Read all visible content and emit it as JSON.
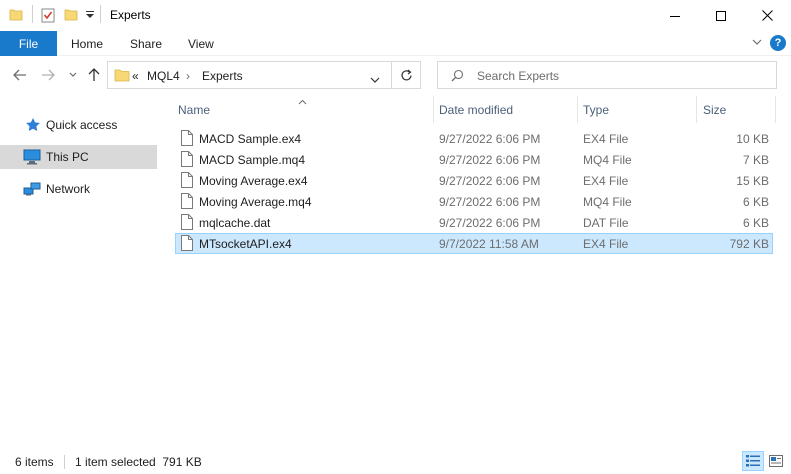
{
  "window": {
    "title": "Experts",
    "minimize_glyph": "–",
    "maximize_glyph": "☐",
    "close_glyph": "✕"
  },
  "ribbon": {
    "tabs": [
      "File",
      "Home",
      "Share",
      "View"
    ],
    "help_glyph": "?"
  },
  "address": {
    "overflow": "«",
    "segments": [
      "MQL4",
      "Experts"
    ],
    "separator": "›"
  },
  "search": {
    "placeholder": "Search Experts"
  },
  "navpane": {
    "items": [
      {
        "label": "Quick access",
        "icon": "star-icon"
      },
      {
        "label": "This PC",
        "icon": "computer-icon",
        "selected": true
      },
      {
        "label": "Network",
        "icon": "network-icon"
      }
    ]
  },
  "columns": {
    "name": "Name",
    "date": "Date modified",
    "type": "Type",
    "size": "Size"
  },
  "files": [
    {
      "name": "MACD Sample.ex4",
      "date": "9/27/2022 6:06 PM",
      "type": "EX4 File",
      "size": "10 KB",
      "selected": false
    },
    {
      "name": "MACD Sample.mq4",
      "date": "9/27/2022 6:06 PM",
      "type": "MQ4 File",
      "size": "7 KB",
      "selected": false
    },
    {
      "name": "Moving Average.ex4",
      "date": "9/27/2022 6:06 PM",
      "type": "EX4 File",
      "size": "15 KB",
      "selected": false
    },
    {
      "name": "Moving Average.mq4",
      "date": "9/27/2022 6:06 PM",
      "type": "MQ4 File",
      "size": "6 KB",
      "selected": false
    },
    {
      "name": "mqlcache.dat",
      "date": "9/27/2022 6:06 PM",
      "type": "DAT File",
      "size": "6 KB",
      "selected": false
    },
    {
      "name": "MTsocketAPI.ex4",
      "date": "9/7/2022 11:58 AM",
      "type": "EX4 File",
      "size": "792 KB",
      "selected": true
    }
  ],
  "status": {
    "item_count": "6 items",
    "selection": "1 item selected  791 KB"
  },
  "colors": {
    "accent": "#1979ca",
    "selection_bg": "#cce8ff",
    "selection_border": "#99d1ff",
    "folder": "#f8d775"
  }
}
